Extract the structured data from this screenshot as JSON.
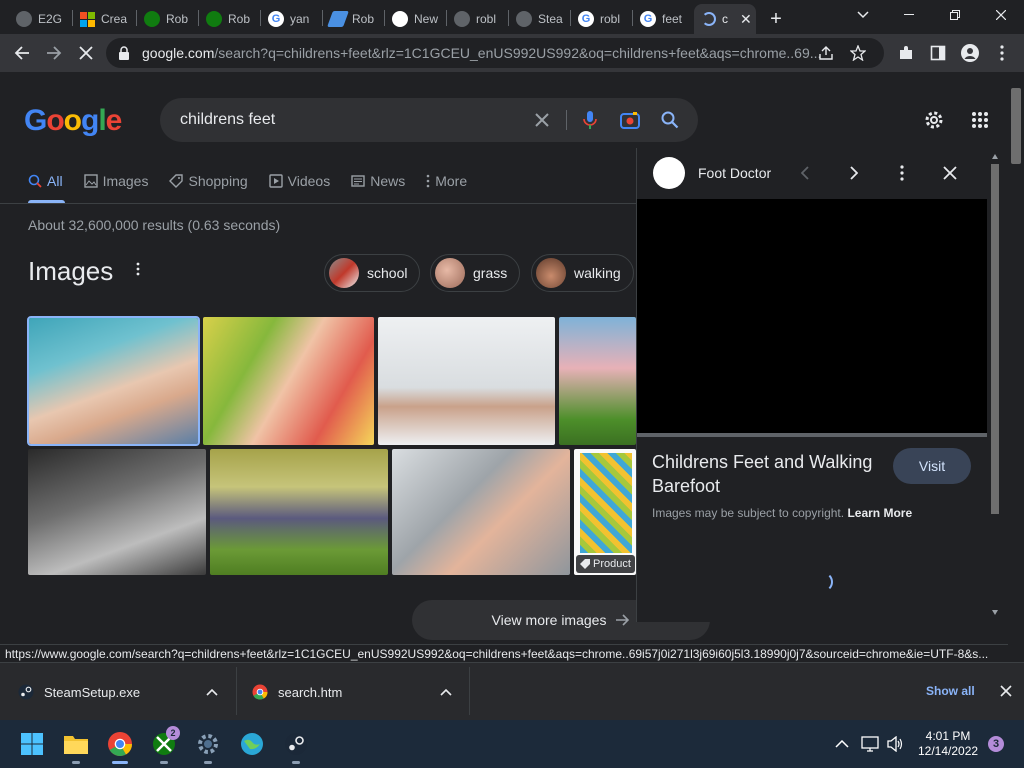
{
  "browser": {
    "tabs": [
      {
        "label": "E2G",
        "icon": "globe-icon",
        "color": "#9aa0a6"
      },
      {
        "label": "Crea",
        "icon": "microsoft-icon",
        "color": "#f25022"
      },
      {
        "label": "Rob",
        "icon": "xbox-icon",
        "color": "#107c10"
      },
      {
        "label": "Rob",
        "icon": "xbox-icon",
        "color": "#107c10"
      },
      {
        "label": "yan",
        "icon": "google-icon",
        "color": "#ffffff"
      },
      {
        "label": "Rob",
        "icon": "roblox-icon",
        "color": "#4a90e2"
      },
      {
        "label": "New",
        "icon": "github-icon",
        "color": "#ffffff"
      },
      {
        "label": "robl",
        "icon": "globe-icon",
        "color": "#9aa0a6"
      },
      {
        "label": "Stea",
        "icon": "globe-icon",
        "color": "#9aa0a6"
      },
      {
        "label": "robl",
        "icon": "google-icon",
        "color": "#ffffff"
      },
      {
        "label": "feet",
        "icon": "google-icon",
        "color": "#ffffff"
      },
      {
        "label": "c",
        "icon": "loading-icon",
        "color": "#8ab4f8",
        "active": true
      }
    ],
    "new_tab_symbol": "+",
    "url_host": "google.com",
    "url_rest": "/search?q=childrens+feet&rlz=1C1GCEU_enUS992US992&oq=childrens+feet&aqs=chrome..69..."
  },
  "search": {
    "logo": "Google",
    "query": "childrens feet"
  },
  "nav_tabs": [
    {
      "label": "All",
      "icon": "search-icon",
      "active": true
    },
    {
      "label": "Images",
      "icon": "image-icon"
    },
    {
      "label": "Shopping",
      "icon": "tag-icon"
    },
    {
      "label": "Videos",
      "icon": "play-icon"
    },
    {
      "label": "News",
      "icon": "news-icon"
    },
    {
      "label": "More",
      "icon": "more-vert-icon"
    }
  ],
  "result_stats": "About 32,600,000 results (0.63 seconds)",
  "images_section": {
    "heading": "Images",
    "chips": [
      "school",
      "grass",
      "walking"
    ],
    "view_more": "View more images",
    "product_badge": "Product"
  },
  "side_panel": {
    "source": "Foot Doctor",
    "title": "Childrens Feet and Walking Barefoot",
    "visit": "Visit",
    "copyright": "Images may be subject to copyright.",
    "learn_more": "Learn More"
  },
  "status_url": "https://www.google.com/search?q=childrens+feet&rlz=1C1GCEU_enUS992US992&oq=childrens+feet&aqs=chrome..69i57j0i271l3j69i60j5l3.18990j0j7&sourceid=chrome&ie=UTF-8&s...",
  "downloads": {
    "items": [
      {
        "name": "SteamSetup.exe",
        "icon": "steam-icon"
      },
      {
        "name": "search.htm",
        "icon": "chrome-icon"
      }
    ],
    "show_all": "Show all"
  },
  "taskbar": {
    "time": "4:01 PM",
    "date": "12/14/2022",
    "xbox_badge": "2",
    "notification_count": "3"
  }
}
